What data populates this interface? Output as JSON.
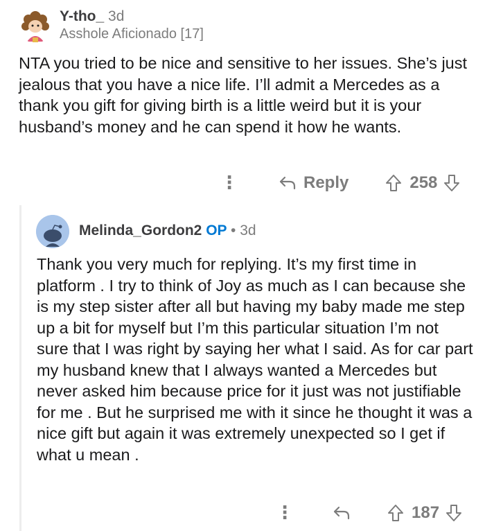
{
  "comment1": {
    "username": "Y-tho_",
    "age": "3d",
    "flair": "Asshole Aficionado [17]",
    "text": "NTA you tried to be nice and sensitive to her issues. She’s just jealous that you have a nice life. I’ll admit a Mercedes as a thank you gift for giving birth is a little weird but it is your husband’s money and he can spend it how he wants.",
    "more_label": "⋮",
    "reply_label": "Reply",
    "score": "258"
  },
  "comment2": {
    "username": "Melinda_Gordon2",
    "op_label": "OP",
    "separator": "•",
    "age": "3d",
    "text": "Thank you very much for replying. It’s my first time in platform . I try to think of Joy as much as I can because she is my step sister after all but having my baby made me step up a bit for myself but I’m  this particular situation I’m not sure that I was right by saying her what I said. As for car part my husband knew that I always wanted a Mercedes but never asked him because price for it just was not justifiable for me . But he surprised me with it since he thought it was a nice gift but again it was extremely unexpected so I get if what u mean .",
    "more_label": "⋮",
    "score": "187"
  },
  "icons": {
    "reply": "reply-arrow-icon",
    "upvote": "upvote-arrow-icon",
    "downvote": "downvote-arrow-icon",
    "avatar1": "snoo-avatar-icon",
    "avatar2": "default-snoo-avatar-icon"
  },
  "colors": {
    "op_blue": "#0079d3",
    "meta_gray": "#7c7c7c",
    "text": "#1a1a1b",
    "avatar2_bg": "#a9c5ea"
  }
}
